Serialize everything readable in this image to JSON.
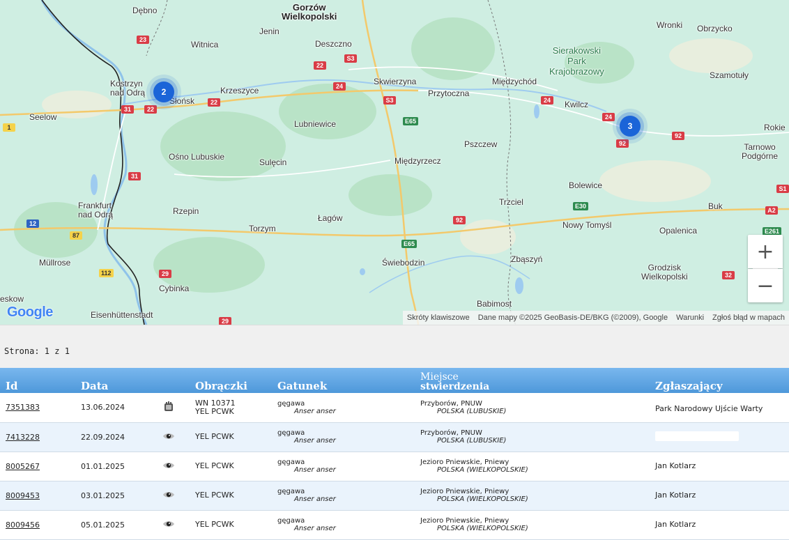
{
  "map": {
    "places": [
      {
        "name": "Dębno"
      },
      {
        "name": "Gorzów\nWielkopolski"
      },
      {
        "name": "Jenin"
      },
      {
        "name": "Witnica"
      },
      {
        "name": "Deszczno"
      },
      {
        "name": "Kostrzyn\nnad Odrą"
      },
      {
        "name": "Krzeszyce"
      },
      {
        "name": "Słońsk"
      },
      {
        "name": "Seelow"
      },
      {
        "name": "Skwierzyna"
      },
      {
        "name": "Przytoczna"
      },
      {
        "name": "Międzychód"
      },
      {
        "name": "Sierakowski\nPark\nKrajobrazowy"
      },
      {
        "name": "Wronki"
      },
      {
        "name": "Obrzycko"
      },
      {
        "name": "Szamotuły"
      },
      {
        "name": "Kwilcz"
      },
      {
        "name": "Lubniewice"
      },
      {
        "name": "Pszczew"
      },
      {
        "name": "Rokie"
      },
      {
        "name": "Tarnowo\nPodgórne"
      },
      {
        "name": "Ośno Lubuskie"
      },
      {
        "name": "Sulęcin"
      },
      {
        "name": "Międzyrzecz"
      },
      {
        "name": "Bolewice"
      },
      {
        "name": "Frankfurt\nnad Odrą"
      },
      {
        "name": "Rzepin"
      },
      {
        "name": "Trzciel"
      },
      {
        "name": "Buk"
      },
      {
        "name": "Łagów"
      },
      {
        "name": "Torzym"
      },
      {
        "name": "Nowy Tomyśl"
      },
      {
        "name": "Opalenica"
      },
      {
        "name": "Müllrose"
      },
      {
        "name": "Świebodzin"
      },
      {
        "name": "Zbąszyń"
      },
      {
        "name": "Grodzisk\nWielkopolski"
      },
      {
        "name": "Cybinka"
      },
      {
        "name": "eskow"
      },
      {
        "name": "Eisenhüttenstadt"
      },
      {
        "name": "Babimost"
      }
    ],
    "clusters": [
      {
        "count": "2"
      },
      {
        "count": "3"
      }
    ],
    "zoom_in_label": "+",
    "zoom_out_label": "−",
    "logo": "Google",
    "attribution": {
      "shortcuts": "Skróty klawiszowe",
      "data": "Dane mapy ©2025 GeoBasis-DE/BKG (©2009), Google",
      "terms": "Warunki",
      "report": "Zgłoś błąd w mapach"
    },
    "colors": {
      "water": "#9ecbf0",
      "land": "#cfeee2",
      "forest": "#b7e1c4",
      "cluster": "#1b64d8"
    }
  },
  "pager": {
    "text": "Strona: 1 z 1"
  },
  "table": {
    "headers": {
      "id": "Id",
      "date": "Data",
      "rings": "Obrączki",
      "species": "Gatunek",
      "place_line1": "Miejsce",
      "place_line2": "stwierdzenia",
      "reporter": "Zgłaszający"
    },
    "rows": [
      {
        "id": "7351383",
        "date": "13.06.2024",
        "icon": "hand-held-bird-icon",
        "ring1": "WN 10371",
        "ring2": "YEL PCWK",
        "species": "gęgawa",
        "latin": "Anser anser",
        "place": "Przyborów, PNUW",
        "country": "POLSKA (LUBUSKIE)",
        "reporter": "Park Narodowy Ujście Warty"
      },
      {
        "id": "7413228",
        "date": "22.09.2024",
        "icon": "eye-icon",
        "ring1": "YEL PCWK",
        "ring2": "",
        "species": "gęgawa",
        "latin": "Anser anser",
        "place": "Przyborów, PNUW",
        "country": "POLSKA (LUBUSKIE)",
        "reporter": ""
      },
      {
        "id": "8005267",
        "date": "01.01.2025",
        "icon": "eye-icon",
        "ring1": "YEL PCWK",
        "ring2": "",
        "species": "gęgawa",
        "latin": "Anser anser",
        "place": "Jezioro Pniewskie, Pniewy",
        "country": "POLSKA (WIELKOPOLSKIE)",
        "reporter": "Jan Kotlarz"
      },
      {
        "id": "8009453",
        "date": "03.01.2025",
        "icon": "eye-icon",
        "ring1": "YEL PCWK",
        "ring2": "",
        "species": "gęgawa",
        "latin": "Anser anser",
        "place": "Jezioro Pniewskie, Pniewy",
        "country": "POLSKA (WIELKOPOLSKIE)",
        "reporter": "Jan Kotlarz"
      },
      {
        "id": "8009456",
        "date": "05.01.2025",
        "icon": "eye-icon",
        "ring1": "YEL PCWK",
        "ring2": "",
        "species": "gęgawa",
        "latin": "Anser anser",
        "place": "Jezioro Pniewskie, Pniewy",
        "country": "POLSKA (WIELKOPOLSKIE)",
        "reporter": "Jan Kotlarz"
      }
    ]
  }
}
